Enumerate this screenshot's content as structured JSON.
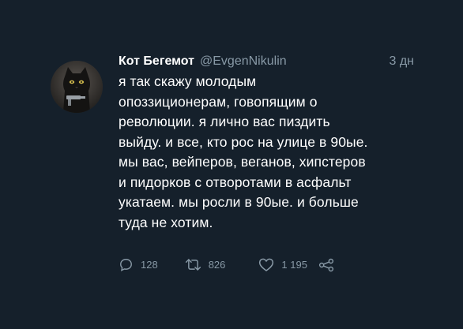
{
  "tweet": {
    "author_name": "Кот Бегемот",
    "handle": "@EvgenNikulin",
    "time": "3 дн",
    "text_lines": [
      "я так скажу молодым",
      "опоззиционерам, говопящим о",
      "революции. я лично вас пиздить",
      "выйду. и все, кто рос на улице в 90ые.",
      "мы вас, вейперов, веганов, хипстеров",
      "и пидорков с отворотами в асфальт",
      "укатаем. мы росли в 90ые. и больше",
      "туда не хотим."
    ],
    "replies": "128",
    "retweets": "826",
    "likes": "1 195"
  },
  "icons": {
    "reply": "reply-icon",
    "retweet": "retweet-icon",
    "like": "heart-icon",
    "share": "share-icon"
  },
  "colors": {
    "background": "#15202b",
    "text": "#ffffff",
    "secondary": "#8899a6"
  }
}
